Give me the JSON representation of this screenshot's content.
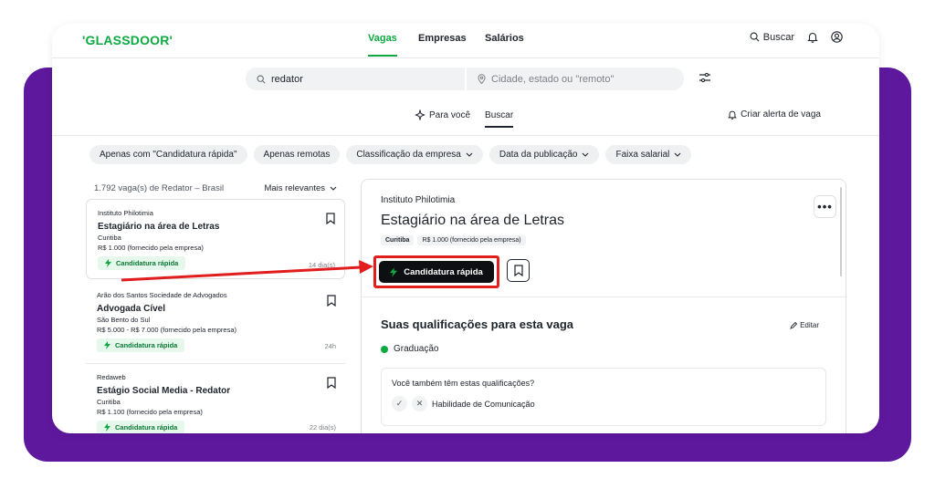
{
  "header": {
    "logo": "'GLASSDOOR'",
    "nav": [
      "Vagas",
      "Empresas",
      "Salários"
    ],
    "search_label": "Buscar"
  },
  "search": {
    "query": "redator",
    "location_placeholder": "Cidade, estado ou \"remoto\""
  },
  "subtabs": {
    "for_you": "Para você",
    "search": "Buscar",
    "create_alert": "Criar alerta de vaga"
  },
  "filters": [
    "Apenas com \"Candidatura rápida\"",
    "Apenas remotas",
    "Classificação da empresa",
    "Data da publicação",
    "Faixa salarial"
  ],
  "results": {
    "count_text": "1.792 vaga(s) de Redator – Brasil",
    "sort": "Mais relevantes",
    "quick_apply_badge": "Candidatura rápida",
    "jobs": [
      {
        "company": "Instituto Philotimia",
        "title": "Estagiário na área de Letras",
        "location": "Curitiba",
        "salary": "R$ 1.000 (fornecido pela empresa)",
        "age": "14 dia(s)"
      },
      {
        "company": "Arão dos Santos Sociedade de Advogados",
        "title": "Advogada Cível",
        "location": "São Bento do Sul",
        "salary": "R$ 5.000 - R$ 7.000 (fornecido pela empresa)",
        "age": "24h"
      },
      {
        "company": "Redaweb",
        "title": "Estágio Social Media - Redator",
        "location": "Curitiba",
        "salary": "R$ 1.100 (fornecido pela empresa)",
        "age": "22 dia(s)"
      }
    ]
  },
  "detail": {
    "company": "Instituto Philotimia",
    "title": "Estagiário na área de Letras",
    "location_tag": "Curitiba",
    "salary_tag": "R$ 1.000 (fornecido pela empresa)",
    "apply_label": "Candidatura rápida",
    "more_label": "•••",
    "qualifications_title": "Suas qualificações para esta vaga",
    "edit_label": "Editar",
    "education": "Graduação",
    "question": "Você também têm estas qualificações?",
    "skill": "Habilidade de Comunicação"
  },
  "colors": {
    "brand_green": "#0caa41",
    "purple_frame": "#5e189e",
    "highlight_red": "#e11d1d"
  }
}
